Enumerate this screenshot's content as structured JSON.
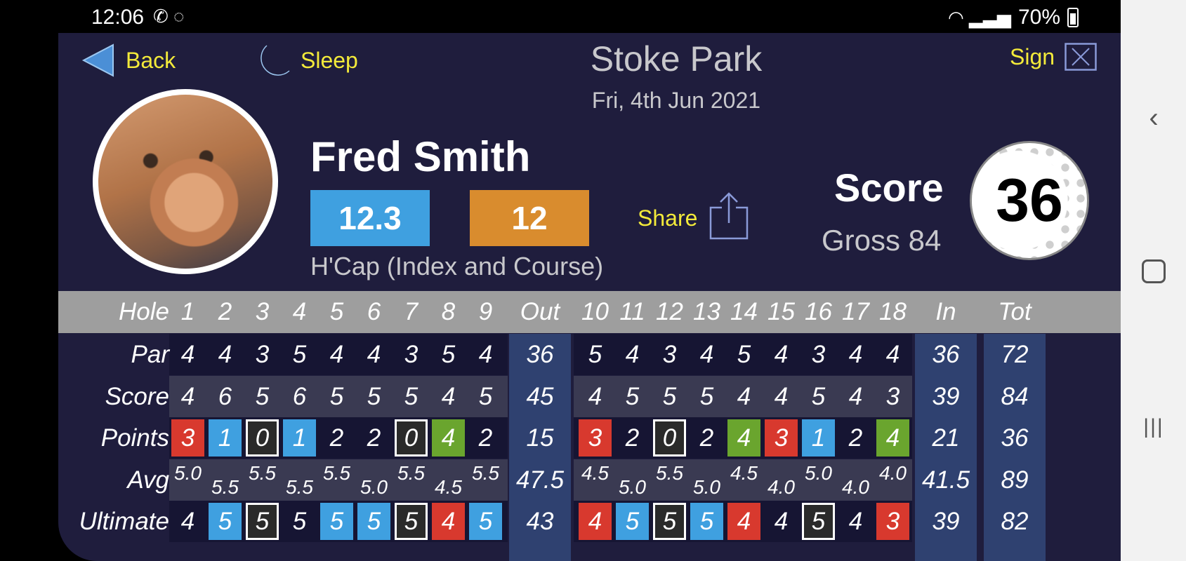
{
  "status_bar": {
    "time": "12:06",
    "battery": "70%"
  },
  "header": {
    "back_label": "Back",
    "sleep_label": "Sleep",
    "course_name": "Stoke Park",
    "date": "Fri, 4th Jun 2021",
    "sign_label": "Sign"
  },
  "player": {
    "name": "Fred Smith",
    "handicap_index": "12.3",
    "course_handicap": "12",
    "handicap_label": "H'Cap (Index and Course)"
  },
  "share_label": "Share",
  "score": {
    "label": "Score",
    "points": "36",
    "gross_text": "Gross 84"
  },
  "colors": {
    "red": "#d8392e",
    "blue": "#3fa0e0",
    "green": "#6aa52e",
    "dark": "#2a2a2a",
    "header_gray": "#9e9e9e",
    "total_col": "#2f4170"
  },
  "scorecard": {
    "header_label": "Hole",
    "holes_out": [
      "1",
      "2",
      "3",
      "4",
      "5",
      "6",
      "7",
      "8",
      "9"
    ],
    "holes_in": [
      "10",
      "11",
      "12",
      "13",
      "14",
      "15",
      "16",
      "17",
      "18"
    ],
    "out_label": "Out",
    "in_label": "In",
    "tot_label": "Tot",
    "rows": [
      {
        "label": "Par",
        "out": [
          "4",
          "4",
          "3",
          "5",
          "4",
          "4",
          "3",
          "5",
          "4"
        ],
        "out_total": "36",
        "in": [
          "5",
          "4",
          "3",
          "4",
          "5",
          "4",
          "3",
          "4",
          "4"
        ],
        "in_total": "36",
        "total": "72"
      },
      {
        "label": "Score",
        "out": [
          "4",
          "6",
          "5",
          "6",
          "5",
          "5",
          "5",
          "4",
          "5"
        ],
        "out_total": "45",
        "in": [
          "4",
          "5",
          "5",
          "5",
          "4",
          "4",
          "5",
          "4",
          "3"
        ],
        "in_total": "39",
        "total": "84"
      },
      {
        "label": "Points",
        "out": [
          "3",
          "1",
          "0",
          "1",
          "2",
          "2",
          "0",
          "4",
          "2"
        ],
        "out_total": "15",
        "in": [
          "3",
          "2",
          "0",
          "2",
          "4",
          "3",
          "1",
          "2",
          "4"
        ],
        "in_total": "21",
        "total": "36",
        "style_out": [
          "red",
          "blue",
          "box",
          "blue",
          "",
          "",
          "box",
          "green",
          ""
        ],
        "style_in": [
          "red",
          "",
          "box",
          "",
          "green",
          "red",
          "blue",
          "",
          "green"
        ]
      },
      {
        "label": "Avg",
        "out": [
          "5.0",
          "5.5",
          "5.5",
          "5.5",
          "5.5",
          "5.0",
          "5.5",
          "4.5",
          "5.5"
        ],
        "out_total": "47.5",
        "in": [
          "4.5",
          "5.0",
          "5.5",
          "5.0",
          "4.5",
          "4.0",
          "5.0",
          "4.0",
          "4.0"
        ],
        "in_total": "41.5",
        "total": "89"
      },
      {
        "label": "Ultimate",
        "out": [
          "4",
          "5",
          "5",
          "5",
          "5",
          "5",
          "5",
          "4",
          "5"
        ],
        "out_total": "43",
        "in": [
          "4",
          "5",
          "5",
          "5",
          "4",
          "4",
          "5",
          "4",
          "3"
        ],
        "in_total": "39",
        "total": "82",
        "style_out": [
          "",
          "blue",
          "box",
          "",
          "blue",
          "blue",
          "box",
          "red",
          "blue"
        ],
        "style_in": [
          "red",
          "blue",
          "box",
          "blue",
          "red",
          "",
          "box",
          "",
          "red"
        ]
      }
    ]
  }
}
